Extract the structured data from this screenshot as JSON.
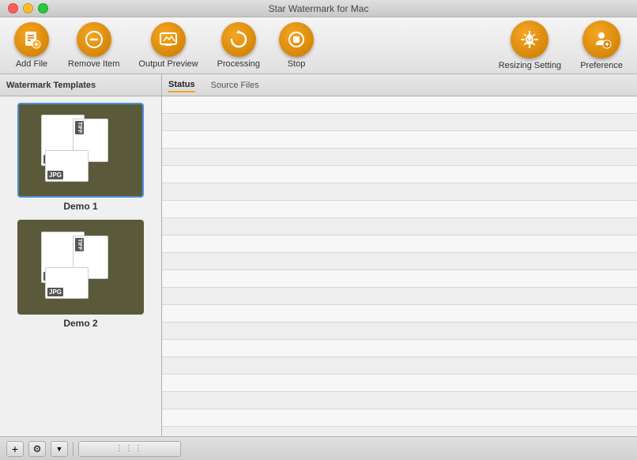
{
  "window": {
    "title": "Star Watermark for Mac"
  },
  "toolbar": {
    "add_file_label": "Add File",
    "remove_item_label": "Remove Item",
    "output_preview_label": "Output Preview",
    "processing_label": "Processing",
    "stop_label": "Stop",
    "resizing_setting_label": "Resizing Setting",
    "preference_label": "Preference"
  },
  "left_panel": {
    "header": "Watermark Templates",
    "templates": [
      {
        "name": "Demo 1"
      },
      {
        "name": "Demo 2"
      }
    ]
  },
  "right_panel": {
    "tabs": [
      {
        "label": "Status",
        "active": true
      },
      {
        "label": "Source Files",
        "active": false
      }
    ]
  },
  "bottom_bar": {
    "add_label": "+",
    "settings_label": "⚙",
    "chevron_label": "▼"
  },
  "stripe_rows": 22
}
